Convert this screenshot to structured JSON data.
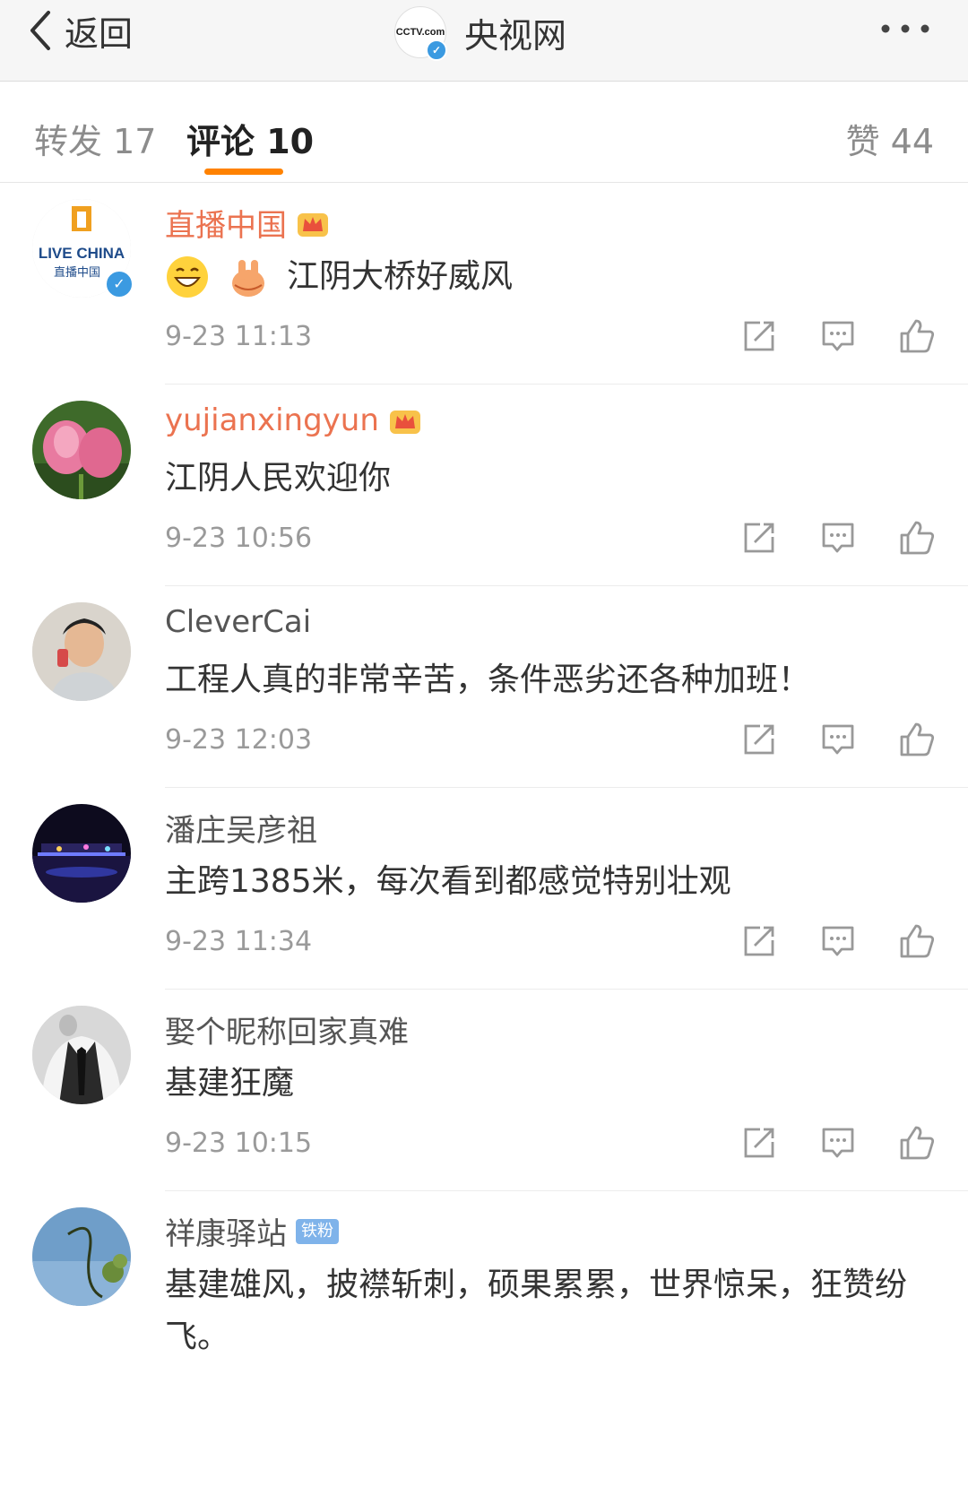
{
  "nav": {
    "back_label": "返回",
    "title": "央视网",
    "logo_text": "CCTV.com"
  },
  "tabs": {
    "repost": "转发 17",
    "comment": "评论 10",
    "like": "赞 44"
  },
  "comments": [
    {
      "user": "直播中国",
      "text": "江阴大桥好威风",
      "time": "9-23 11:13",
      "logo": "LIVE CHINA",
      "logo_sub": "直播中国"
    },
    {
      "user": "yujianxingyun",
      "text": "江阴人民欢迎你",
      "time": "9-23 10:56"
    },
    {
      "user": "CleverCai",
      "text": "工程人真的非常辛苦，条件恶劣还各种加班！",
      "time": "9-23 12:03"
    },
    {
      "user": "潘庄吴彦祖",
      "text": "主跨1385米，每次看到都感觉特别壮观",
      "time": "9-23 11:34"
    },
    {
      "user": "娶个昵称回家真难",
      "text": "基建狂魔",
      "time": "9-23 10:15"
    },
    {
      "user": "祥康驿站",
      "badge": "铁粉",
      "text": "基建雄风，披襟斩刺，硕果累累，世界惊呆，狂赞纷飞。"
    }
  ],
  "colors": {
    "accent": "#ff8200",
    "vip_name": "#eb7350",
    "verify": "#3b9ae1"
  },
  "icons": [
    "back-chevron-icon",
    "more-icon",
    "repost-icon",
    "reply-icon",
    "like-icon",
    "crown-icon",
    "verified-icon"
  ]
}
